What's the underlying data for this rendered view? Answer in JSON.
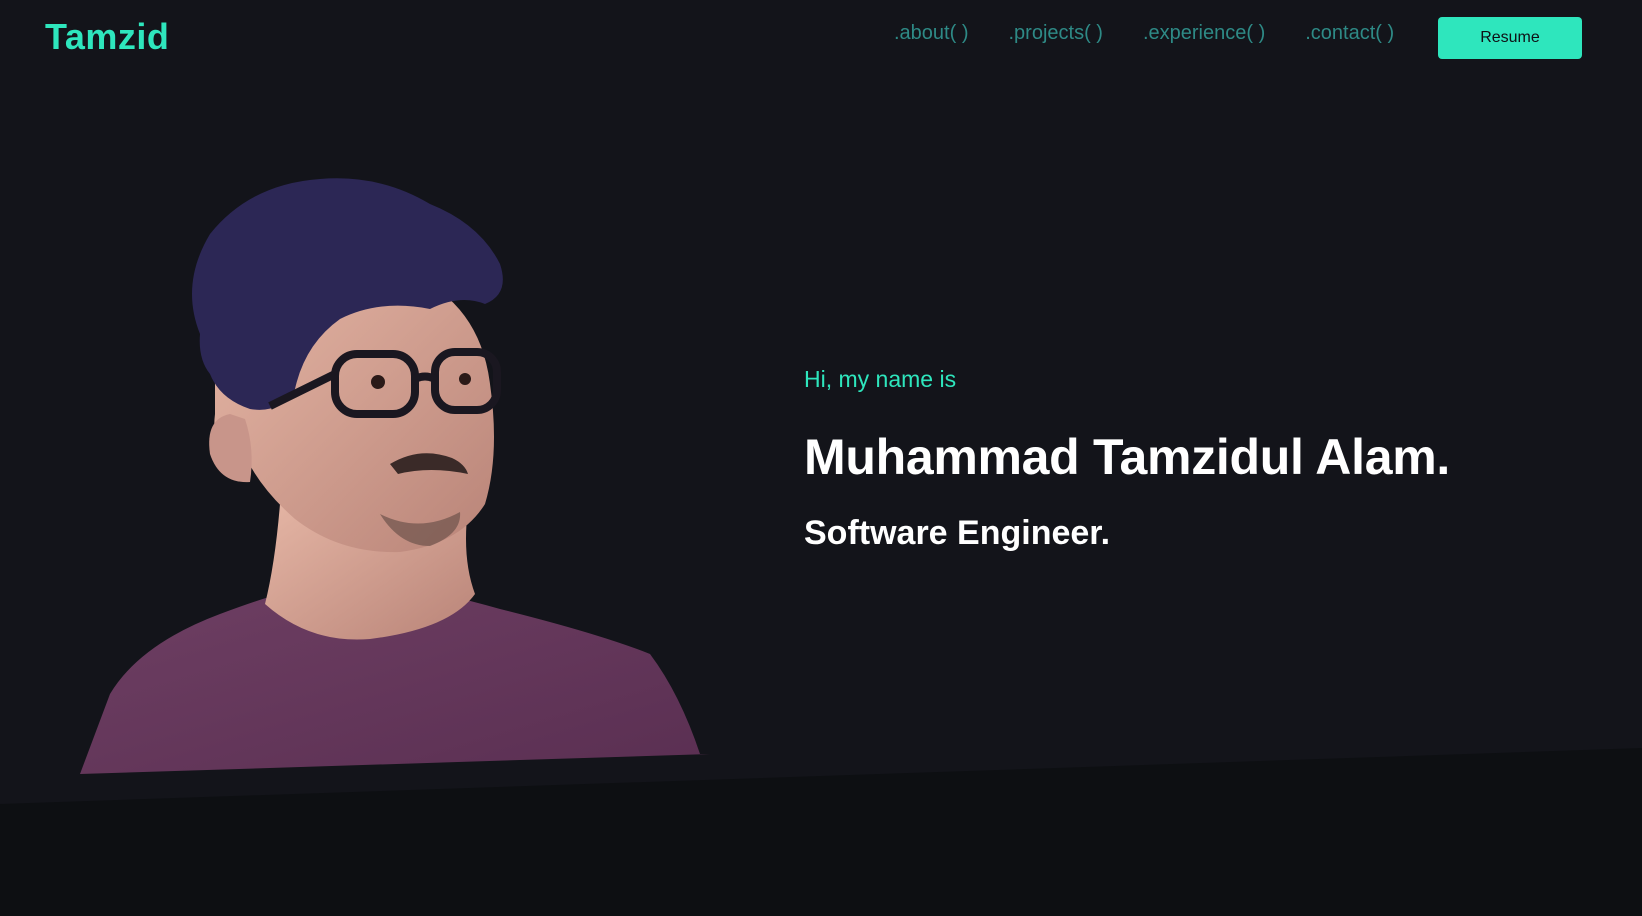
{
  "header": {
    "logo": "Tamzid",
    "nav": [
      {
        "label": ".about( )"
      },
      {
        "label": ".projects( )"
      },
      {
        "label": ".experience( )"
      },
      {
        "label": ".contact( )"
      }
    ],
    "resume_label": "Resume"
  },
  "hero": {
    "greeting": "Hi, my name is",
    "name": "Muhammad Tamzidul Alam.",
    "role": "Software Engineer."
  },
  "colors": {
    "background": "#13141a",
    "accent": "#2ee6bd",
    "nav_text": "#2e8a86",
    "bottom_band": "#0d0f12"
  }
}
